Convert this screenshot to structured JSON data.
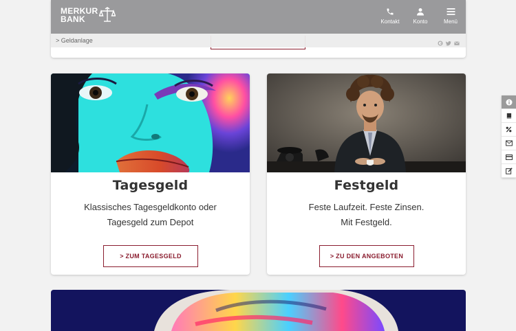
{
  "header": {
    "logo_text": "MERKUR\nBANK",
    "nav": [
      {
        "icon": "phone-icon",
        "label": "Kontakt"
      },
      {
        "icon": "user-icon",
        "label": "Konto"
      },
      {
        "icon": "hamburger-menu-icon",
        "label": "Menü"
      }
    ]
  },
  "breadcrumb": {
    "text": "> Geldanlage",
    "social_icons": [
      "google-plus-icon",
      "twitter-icon",
      "mail-icon"
    ]
  },
  "cards": [
    {
      "title": "Tagesgeld",
      "desc_line1": "Klassisches Tagesgeldkonto oder",
      "desc_line2": "Tagesgeld zum Depot",
      "button": "> ZUM TAGESGELD",
      "image": "colorful-face-painting-photo"
    },
    {
      "title": "Festgeld",
      "desc_line1": "Feste Laufzeit. Feste Zinsen.",
      "desc_line2": "Mit Festgeld.",
      "button": "> ZU DEN ANGEBOTEN",
      "image": "man-in-suit-at-desk-photo"
    }
  ],
  "side_toolbar": [
    "info-icon",
    "book-icon",
    "percent-icon",
    "mail-icon",
    "credit-card-icon",
    "edit-icon"
  ],
  "colors": {
    "brand": "#8a1c2e",
    "header_bg": "#969698",
    "page_bg": "#f2f2f2"
  }
}
